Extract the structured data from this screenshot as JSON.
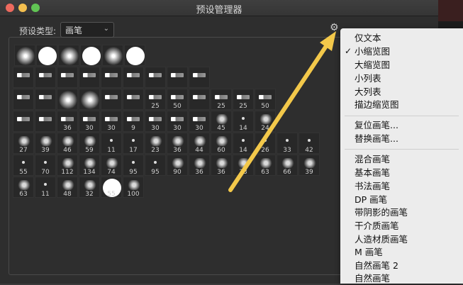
{
  "window": {
    "title": "预设管理器"
  },
  "toolbar": {
    "preset_type_label": "预设类型:",
    "preset_type_value": "画笔"
  },
  "menu": {
    "view_options": [
      "仅文本",
      "小缩览图",
      "大缩览图",
      "小列表",
      "大列表",
      "描边缩览图"
    ],
    "checked_index": 1,
    "actions": [
      "复位画笔...",
      "替换画笔..."
    ],
    "libraries": [
      "混合画笔",
      "基本画笔",
      "书法画笔",
      "DP 画笔",
      "带阴影的画笔",
      "干介质画笔",
      "人造材质画笔",
      "M 画笔",
      "自然画笔 2",
      "自然画笔"
    ]
  },
  "brushes": [
    {
      "kind": "soft",
      "num": ""
    },
    {
      "kind": "hard",
      "num": ""
    },
    {
      "kind": "soft",
      "num": ""
    },
    {
      "kind": "hard",
      "num": ""
    },
    {
      "kind": "soft",
      "num": ""
    },
    {
      "kind": "hard",
      "num": ""
    },
    {
      "kind": "brush",
      "num": ""
    },
    {
      "kind": "brush",
      "num": ""
    },
    {
      "kind": "brush",
      "num": ""
    },
    {
      "kind": "brush",
      "num": ""
    },
    {
      "kind": "brush",
      "num": ""
    },
    {
      "kind": "brush",
      "num": ""
    },
    {
      "kind": "brush",
      "num": ""
    },
    {
      "kind": "brush",
      "num": ""
    },
    {
      "kind": "brush",
      "num": ""
    },
    {
      "kind": "brush",
      "num": ""
    },
    {
      "kind": "brush",
      "num": ""
    },
    {
      "kind": "soft",
      "num": ""
    },
    {
      "kind": "soft",
      "num": ""
    },
    {
      "kind": "brush",
      "num": ""
    },
    {
      "kind": "brush",
      "num": ""
    },
    {
      "kind": "brush",
      "num": "25"
    },
    {
      "kind": "brush",
      "num": "50"
    },
    {
      "kind": "brush",
      "num": ""
    },
    {
      "kind": "brush",
      "num": "25"
    },
    {
      "kind": "brush",
      "num": "25"
    },
    {
      "kind": "brush",
      "num": "50"
    },
    {
      "kind": "brush",
      "num": ""
    },
    {
      "kind": "brush",
      "num": ""
    },
    {
      "kind": "brush",
      "num": "36"
    },
    {
      "kind": "brush",
      "num": "30"
    },
    {
      "kind": "brush",
      "num": "30"
    },
    {
      "kind": "brush",
      "num": "9"
    },
    {
      "kind": "brush",
      "num": "30"
    },
    {
      "kind": "brush",
      "num": "30"
    },
    {
      "kind": "brush",
      "num": "30"
    },
    {
      "kind": "splat",
      "num": "45"
    },
    {
      "kind": "dot",
      "num": "14"
    },
    {
      "kind": "splat",
      "num": "24"
    },
    {
      "kind": "splat",
      "num": "27"
    },
    {
      "kind": "splat",
      "num": "39"
    },
    {
      "kind": "splat",
      "num": "46"
    },
    {
      "kind": "splat",
      "num": "59"
    },
    {
      "kind": "dot",
      "num": "11"
    },
    {
      "kind": "dot",
      "num": "17"
    },
    {
      "kind": "splat",
      "num": "23"
    },
    {
      "kind": "splat",
      "num": "36"
    },
    {
      "kind": "splat",
      "num": "44"
    },
    {
      "kind": "splat",
      "num": "60"
    },
    {
      "kind": "dot",
      "num": "14"
    },
    {
      "kind": "dot",
      "num": "26"
    },
    {
      "kind": "dot",
      "num": "33"
    },
    {
      "kind": "dot",
      "num": "42"
    },
    {
      "kind": "dot",
      "num": "55"
    },
    {
      "kind": "dot",
      "num": "70"
    },
    {
      "kind": "splat",
      "num": "112"
    },
    {
      "kind": "splat",
      "num": "134"
    },
    {
      "kind": "splat",
      "num": "74"
    },
    {
      "kind": "dot",
      "num": "95"
    },
    {
      "kind": "dot",
      "num": "95"
    },
    {
      "kind": "splat",
      "num": "90"
    },
    {
      "kind": "splat",
      "num": "36"
    },
    {
      "kind": "splat",
      "num": "36"
    },
    {
      "kind": "splat",
      "num": "33"
    },
    {
      "kind": "splat",
      "num": "63"
    },
    {
      "kind": "splat",
      "num": "66"
    },
    {
      "kind": "splat",
      "num": "39"
    },
    {
      "kind": "splat",
      "num": "63"
    },
    {
      "kind": "dot",
      "num": "11"
    },
    {
      "kind": "splat",
      "num": "48"
    },
    {
      "kind": "splat",
      "num": "32"
    },
    {
      "kind": "hard",
      "num": "55"
    },
    {
      "kind": "splat",
      "num": "100"
    }
  ],
  "colors": {
    "arrow": "#f3c84a",
    "menu_bg": "#ececec",
    "panel_bg": "#2e2e2e"
  }
}
